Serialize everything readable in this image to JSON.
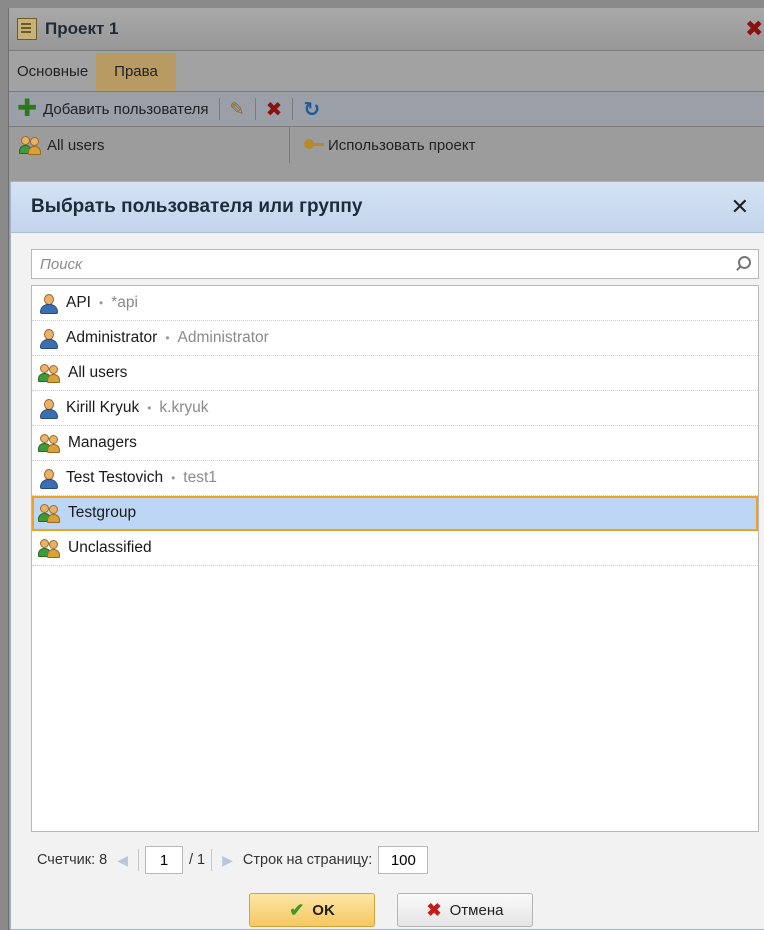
{
  "project_window": {
    "title": "Проект 1",
    "tabs": [
      {
        "label": "Основные"
      },
      {
        "label": "Права"
      }
    ],
    "active_tab": "Права",
    "toolbar": {
      "add_user_label": "Добавить пользователя"
    },
    "permission_row": {
      "subject": "All users",
      "permission": "Использовать проект"
    }
  },
  "dialog": {
    "title": "Выбрать пользователя или группу",
    "search_placeholder": "Поиск",
    "items": [
      {
        "type": "user",
        "name": "API",
        "login": "*api"
      },
      {
        "type": "user",
        "name": "Administrator",
        "login": "Administrator"
      },
      {
        "type": "group",
        "name": "All users"
      },
      {
        "type": "user",
        "name": "Kirill Kryuk",
        "login": "k.kryuk"
      },
      {
        "type": "group",
        "name": "Managers"
      },
      {
        "type": "user",
        "name": "Test Testovich",
        "login": "test1"
      },
      {
        "type": "group",
        "name": "Testgroup",
        "selected": true
      },
      {
        "type": "group",
        "name": "Unclassified"
      }
    ],
    "pager": {
      "count_label": "Счетчик: 8",
      "page": "1",
      "total_pages": "/ 1",
      "rows_per_page_label": "Строк на страницу:",
      "rows_per_page": "100"
    },
    "ok_label": "OK",
    "cancel_label": "Отмена"
  },
  "colors": {
    "selection": "#bdd6f5",
    "selection_border": "#f0a21c",
    "dialog_header": "#c8d9ee",
    "ok_button": "#f6c760"
  },
  "icons": [
    "document-icon",
    "close-icon",
    "add-icon",
    "edit-pencil-icon",
    "delete-icon",
    "refresh-icon",
    "group-icon",
    "key-icon",
    "user-icon",
    "search-icon",
    "prev-page-icon",
    "next-page-icon",
    "check-icon"
  ]
}
